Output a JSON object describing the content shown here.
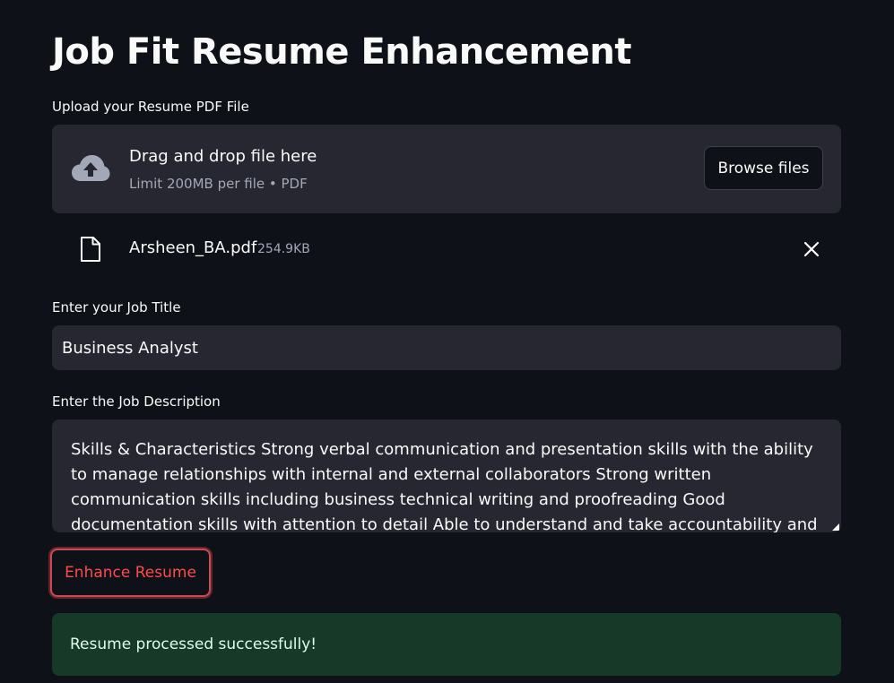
{
  "app": {
    "title": "Job Fit Resume Enhancement"
  },
  "upload": {
    "label": "Upload your Resume PDF File",
    "drop_text": "Drag and drop file here",
    "limit_text": "Limit 200MB per file • PDF",
    "browse_label": "Browse files",
    "icon": "cloud-upload-icon"
  },
  "uploaded_file": {
    "name": "Arsheen_BA.pdf",
    "size": "254.9KB",
    "icon": "file-icon",
    "remove_icon": "close-icon"
  },
  "job_title": {
    "label": "Enter your Job Title",
    "value": "Business Analyst"
  },
  "job_description": {
    "label": "Enter the Job Description",
    "value": "Skills & Characteristics Strong verbal communication and presentation skills with the ability to manage relationships with internal and external collaborators Strong written communication skills including business technical writing and proofreading Good documentation skills with attention to detail Able to understand and take accountability and ownership for task assigned Able to"
  },
  "actions": {
    "enhance_label": "Enhance Resume"
  },
  "status": {
    "message": "Resume processed successfully!"
  },
  "colors": {
    "background": "#0e1117",
    "widget_background": "#262730",
    "primary": "#ff4b4b",
    "success_background": "#173928",
    "success_text": "#dffde9"
  }
}
